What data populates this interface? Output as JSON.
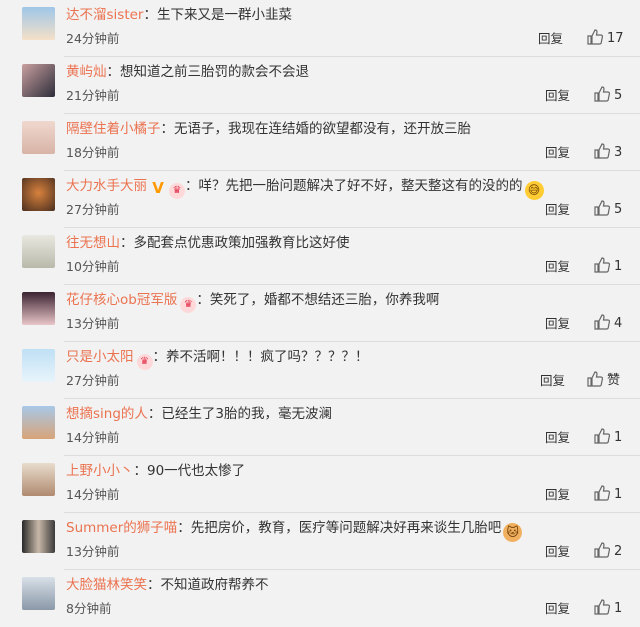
{
  "comments": [
    {
      "user": "达不溜sister",
      "text": "：生下来又是一群小韭菜",
      "time": "24分钟前",
      "reply": "回复",
      "likes": "17"
    },
    {
      "user": "黄屿灿",
      "text": "：想知道之前三胎罚的款会不会退",
      "time": "21分钟前",
      "reply": "回复",
      "likes": "5"
    },
    {
      "user": "隔壁住着小橘子",
      "text": "：无语子，我现在连结婚的欲望都没有，还开放三胎",
      "time": "18分钟前",
      "reply": "回复",
      "likes": "3"
    },
    {
      "user": "大力水手大丽",
      "text": "：咩？先把一胎问题解决了好不好，整天整这有的没的的",
      "time": "27分钟前",
      "reply": "回复",
      "likes": "5"
    },
    {
      "user": "往无想山",
      "text": "：多配套点优惠政策加强教育比这好使",
      "time": "10分钟前",
      "reply": "回复",
      "likes": "1"
    },
    {
      "user": "花仔核心ob冠军版",
      "text": "：笑死了，婚都不想结还三胎，你养我啊",
      "time": "13分钟前",
      "reply": "回复",
      "likes": "4"
    },
    {
      "user": "只是小太阳",
      "text": "：养不活啊！！！疯了吗？？？？！",
      "time": "27分钟前",
      "reply": "回复",
      "likes": "赞"
    },
    {
      "user": "想摘sing的人",
      "text": "：已经生了3胎的我，毫无波澜",
      "time": "14分钟前",
      "reply": "回复",
      "likes": "1"
    },
    {
      "user": "上野小小丶",
      "text": "：90一代也太惨了",
      "time": "14分钟前",
      "reply": "回复",
      "likes": "1"
    },
    {
      "user": "Summer的狮子喵",
      "text": "：先把房价，教育，医疗等问题解决好再来谈生几胎吧",
      "time": "13分钟前",
      "reply": "回复",
      "likes": "2"
    },
    {
      "user": "大脸猫林笑笑",
      "text": "：不知道政府帮养不",
      "time": "8分钟前",
      "reply": "回复",
      "likes": "1"
    }
  ],
  "colors": {
    "username": "#eb7350",
    "background": "#f2f2f2"
  }
}
